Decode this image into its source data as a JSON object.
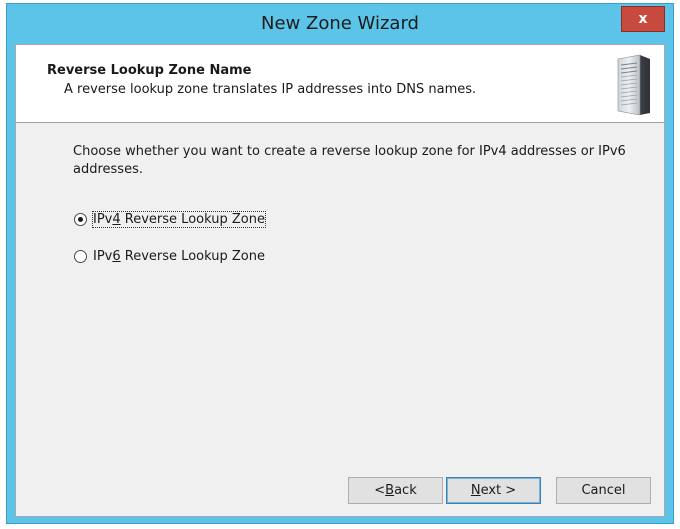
{
  "window": {
    "title": "New Zone Wizard",
    "close_label": "x"
  },
  "header": {
    "title": "Reverse Lookup Zone Name",
    "subtitle": "A reverse lookup zone translates IP addresses into DNS names.",
    "icon": "server-icon"
  },
  "content": {
    "prompt": "Choose whether you want to create a reverse lookup zone for IPv4 addresses or IPv6 addresses.",
    "options": [
      {
        "pre": "IPv",
        "accel": "4",
        "post": " Reverse Lookup Zone",
        "selected": true
      },
      {
        "pre": "IPv",
        "accel": "6",
        "post": " Reverse Lookup Zone",
        "selected": false
      }
    ]
  },
  "buttons": {
    "back": {
      "pre": "< ",
      "accel": "B",
      "post": "ack"
    },
    "next": {
      "pre": "",
      "accel": "N",
      "post": "ext >"
    },
    "cancel": {
      "label": "Cancel"
    }
  },
  "colors": {
    "titlebar": "#5bc4e8",
    "close": "#c74a3f",
    "client_bg": "#f0f0f0"
  }
}
